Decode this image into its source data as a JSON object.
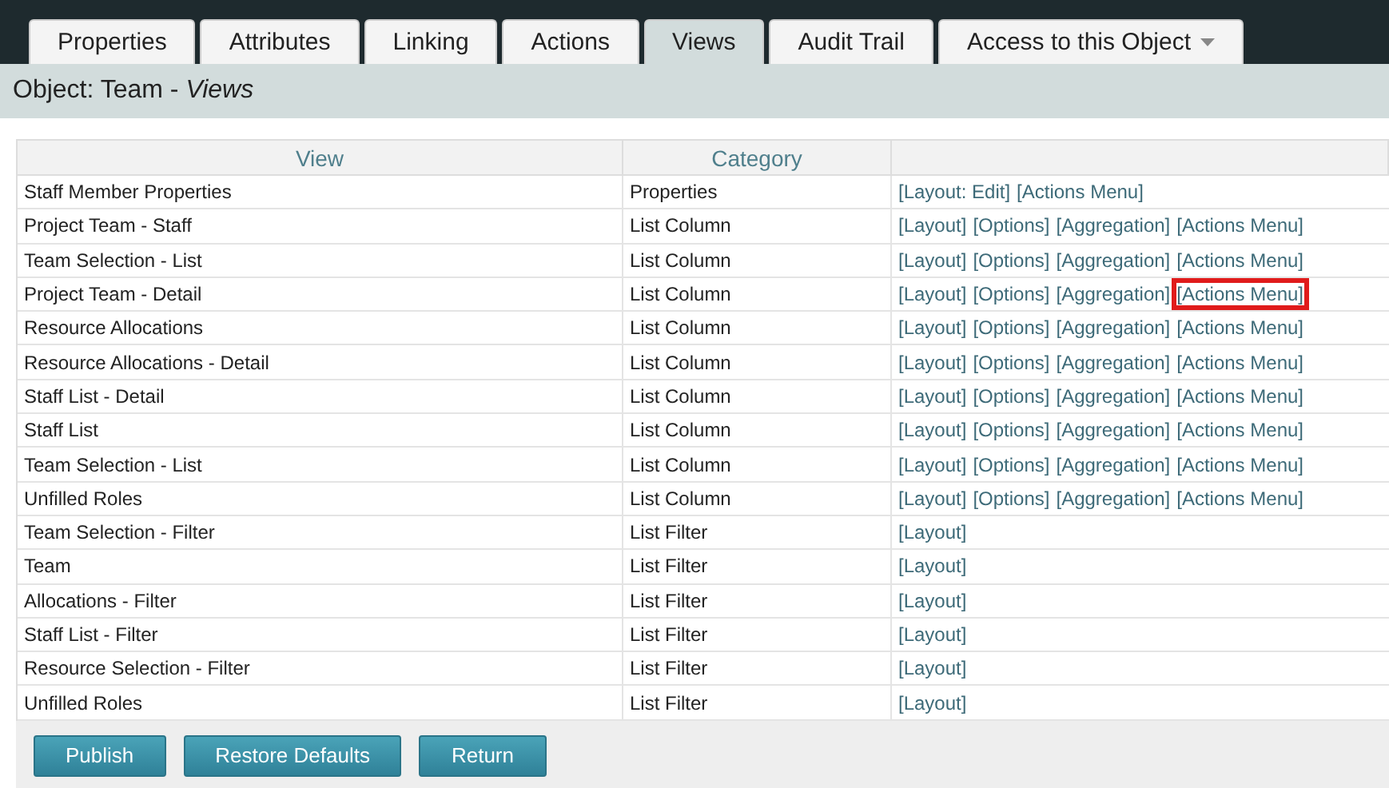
{
  "tabs": [
    {
      "label": "Properties",
      "selected": false,
      "dropdown": false
    },
    {
      "label": "Attributes",
      "selected": false,
      "dropdown": false
    },
    {
      "label": "Linking",
      "selected": false,
      "dropdown": false
    },
    {
      "label": "Actions",
      "selected": false,
      "dropdown": false
    },
    {
      "label": "Views",
      "selected": true,
      "dropdown": false
    },
    {
      "label": "Audit Trail",
      "selected": false,
      "dropdown": false
    },
    {
      "label": "Access to this Object",
      "selected": false,
      "dropdown": true
    }
  ],
  "header": {
    "prefix": "Object: Team - ",
    "page": "Views"
  },
  "table": {
    "columns": [
      "View",
      "Category"
    ],
    "rows": [
      {
        "view": "Staff Member Properties",
        "category": "Properties",
        "links": [
          {
            "label": "[Layout: Edit]",
            "highlighted": false
          },
          {
            "label": "[Actions Menu]",
            "highlighted": false
          }
        ]
      },
      {
        "view": "Project Team - Staff",
        "category": "List Column",
        "links": [
          {
            "label": "[Layout]",
            "highlighted": false
          },
          {
            "label": "[Options]",
            "highlighted": false
          },
          {
            "label": "[Aggregation]",
            "highlighted": false
          },
          {
            "label": "[Actions Menu]",
            "highlighted": false
          }
        ]
      },
      {
        "view": "Team Selection - List",
        "category": "List Column",
        "links": [
          {
            "label": "[Layout]",
            "highlighted": false
          },
          {
            "label": "[Options]",
            "highlighted": false
          },
          {
            "label": "[Aggregation]",
            "highlighted": false
          },
          {
            "label": "[Actions Menu]",
            "highlighted": false
          }
        ]
      },
      {
        "view": "Project Team - Detail",
        "category": "List Column",
        "links": [
          {
            "label": "[Layout]",
            "highlighted": false
          },
          {
            "label": "[Options]",
            "highlighted": false
          },
          {
            "label": "[Aggregation]",
            "highlighted": false
          },
          {
            "label": "[Actions Menu]",
            "highlighted": true
          }
        ]
      },
      {
        "view": "Resource Allocations",
        "category": "List Column",
        "links": [
          {
            "label": "[Layout]",
            "highlighted": false
          },
          {
            "label": "[Options]",
            "highlighted": false
          },
          {
            "label": "[Aggregation]",
            "highlighted": false
          },
          {
            "label": "[Actions Menu]",
            "highlighted": false
          }
        ]
      },
      {
        "view": "Resource Allocations - Detail",
        "category": "List Column",
        "links": [
          {
            "label": "[Layout]",
            "highlighted": false
          },
          {
            "label": "[Options]",
            "highlighted": false
          },
          {
            "label": "[Aggregation]",
            "highlighted": false
          },
          {
            "label": "[Actions Menu]",
            "highlighted": false
          }
        ]
      },
      {
        "view": "Staff List - Detail",
        "category": "List Column",
        "links": [
          {
            "label": "[Layout]",
            "highlighted": false
          },
          {
            "label": "[Options]",
            "highlighted": false
          },
          {
            "label": "[Aggregation]",
            "highlighted": false
          },
          {
            "label": "[Actions Menu]",
            "highlighted": false
          }
        ]
      },
      {
        "view": "Staff List",
        "category": "List Column",
        "links": [
          {
            "label": "[Layout]",
            "highlighted": false
          },
          {
            "label": "[Options]",
            "highlighted": false
          },
          {
            "label": "[Aggregation]",
            "highlighted": false
          },
          {
            "label": "[Actions Menu]",
            "highlighted": false
          }
        ]
      },
      {
        "view": "Team Selection - List",
        "category": "List Column",
        "links": [
          {
            "label": "[Layout]",
            "highlighted": false
          },
          {
            "label": "[Options]",
            "highlighted": false
          },
          {
            "label": "[Aggregation]",
            "highlighted": false
          },
          {
            "label": "[Actions Menu]",
            "highlighted": false
          }
        ]
      },
      {
        "view": "Unfilled Roles",
        "category": "List Column",
        "links": [
          {
            "label": "[Layout]",
            "highlighted": false
          },
          {
            "label": "[Options]",
            "highlighted": false
          },
          {
            "label": "[Aggregation]",
            "highlighted": false
          },
          {
            "label": "[Actions Menu]",
            "highlighted": false
          }
        ]
      },
      {
        "view": "Team Selection - Filter",
        "category": "List Filter",
        "links": [
          {
            "label": "[Layout]",
            "highlighted": false
          }
        ]
      },
      {
        "view": "Team",
        "category": "List Filter",
        "links": [
          {
            "label": "[Layout]",
            "highlighted": false
          }
        ]
      },
      {
        "view": "Allocations - Filter",
        "category": "List Filter",
        "links": [
          {
            "label": "[Layout]",
            "highlighted": false
          }
        ]
      },
      {
        "view": "Staff List - Filter",
        "category": "List Filter",
        "links": [
          {
            "label": "[Layout]",
            "highlighted": false
          }
        ]
      },
      {
        "view": "Resource Selection - Filter",
        "category": "List Filter",
        "links": [
          {
            "label": "[Layout]",
            "highlighted": false
          }
        ]
      },
      {
        "view": "Unfilled Roles",
        "category": "List Filter",
        "links": [
          {
            "label": "[Layout]",
            "highlighted": false
          }
        ]
      }
    ]
  },
  "buttons": [
    "Publish",
    "Restore Defaults",
    "Return"
  ]
}
